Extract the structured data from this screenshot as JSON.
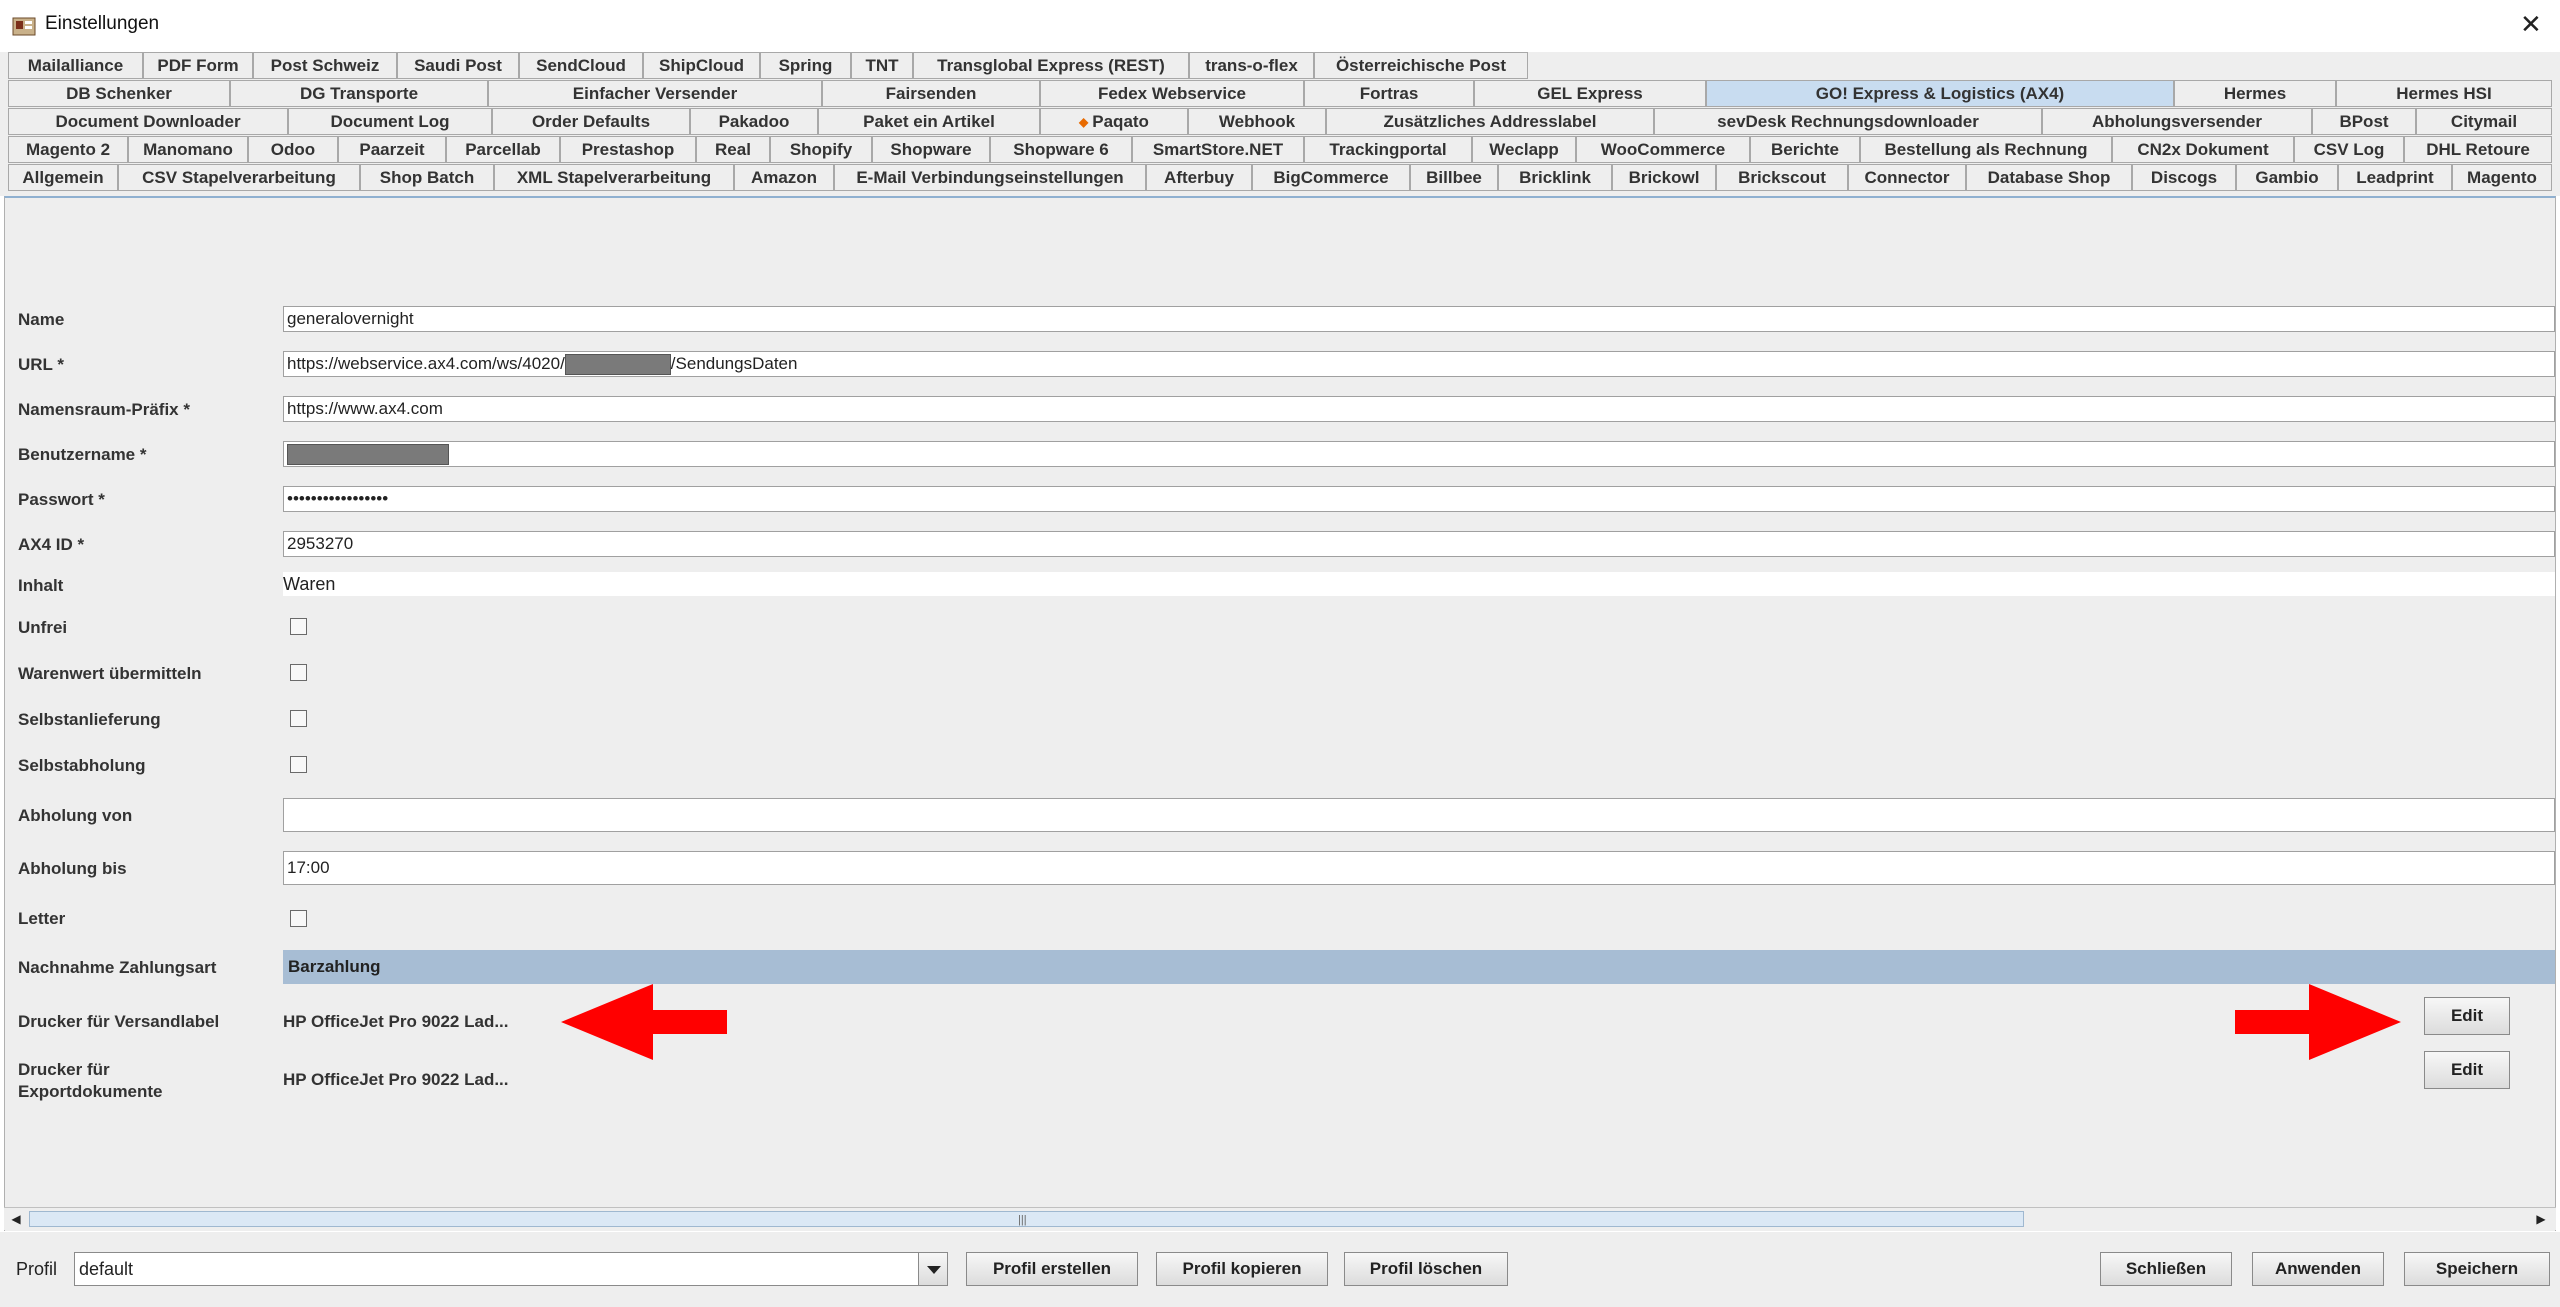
{
  "window": {
    "title": "Einstellungen",
    "close": "✕"
  },
  "tabs": {
    "row1": [
      "Mailalliance",
      "PDF Form",
      "Post Schweiz",
      "Saudi Post",
      "SendCloud",
      "ShipCloud",
      "Spring",
      "TNT",
      "Transglobal Express (REST)",
      "trans-o-flex",
      "Österreichische Post"
    ],
    "row2": [
      "DB Schenker",
      "DG Transporte",
      "Einfacher Versender",
      "Fairsenden",
      "Fedex Webservice",
      "Fortras",
      "GEL Express",
      "GO! Express & Logistics (AX4)",
      "Hermes",
      "Hermes HSI"
    ],
    "row3": [
      "Document Downloader",
      "Document Log",
      "Order Defaults",
      "Pakadoo",
      "Paket ein Artikel",
      "Paqato",
      "Webhook",
      "Zusätzliches Addresslabel",
      "sevDesk Rechnungsdownloader",
      "Abholungsversender",
      "BPost",
      "Citymail"
    ],
    "row4": [
      "Magento 2",
      "Manomano",
      "Odoo",
      "Paarzeit",
      "Parcellab",
      "Prestashop",
      "Real",
      "Shopify",
      "Shopware",
      "Shopware 6",
      "SmartStore.NET",
      "Trackingportal",
      "Weclapp",
      "WooCommerce",
      "Berichte",
      "Bestellung als Rechnung",
      "CN2x Dokument",
      "CSV Log",
      "DHL Retoure"
    ],
    "row5": [
      "Allgemein",
      "CSV Stapelverarbeitung",
      "Shop Batch",
      "XML Stapelverarbeitung",
      "Amazon",
      "E-Mail Verbindungseinstellungen",
      "Afterbuy",
      "BigCommerce",
      "Billbee",
      "Bricklink",
      "Brickowl",
      "Brickscout",
      "Connector",
      "Database Shop",
      "Discogs",
      "Gambio",
      "Leadprint",
      "Magento"
    ],
    "selected": "GO! Express & Logistics (AX4)"
  },
  "form": {
    "name_label": "Name",
    "name_value": "generalovernight",
    "url_label": "URL *",
    "url_prefix": "https://webservice.ax4.com/ws/4020/",
    "url_suffix": "/SendungsDaten",
    "namespace_label": "Namensraum-Präfix *",
    "namespace_value": "https://www.ax4.com",
    "user_label": "Benutzername *",
    "password_label": "Passwort *",
    "password_value": "•••••••••••••••••",
    "ax4id_label": "AX4 ID *",
    "ax4id_value": "2953270",
    "content_label": "Inhalt",
    "content_value": "Waren",
    "unfrei_label": "Unfrei",
    "warenwert_label": "Warenwert übermitteln",
    "selbstanlieferung_label": "Selbstanlieferung",
    "selbstabholung_label": "Selbstabholung",
    "abholung_von_label": "Abholung von",
    "abholung_von_value": "",
    "abholung_bis_label": "Abholung bis",
    "abholung_bis_value": "17:00",
    "letter_label": "Letter",
    "nachnahme_label": "Nachnahme Zahlungsart",
    "nachnahme_value": "Barzahlung",
    "printer_label_label": "Drucker für Versandlabel",
    "printer_label_value": "HP OfficeJet Pro 9022 Lad...",
    "printer_export_label_line1": "Drucker für",
    "printer_export_label_line2": "Exportdokumente",
    "printer_export_value": "HP OfficeJet Pro 9022 Lad...",
    "edit_label": "Edit"
  },
  "footer": {
    "profile_label": "Profil",
    "profile_value": "default",
    "create": "Profil erstellen",
    "copy": "Profil kopieren",
    "delete": "Profil löschen",
    "close": "Schließen",
    "apply": "Anwenden",
    "save": "Speichern"
  },
  "colors": {
    "selected_tab": "#c8dcf0",
    "select_bar": "#a7bdd4",
    "arrow": "#ff0000",
    "background": "#eeeeee"
  }
}
